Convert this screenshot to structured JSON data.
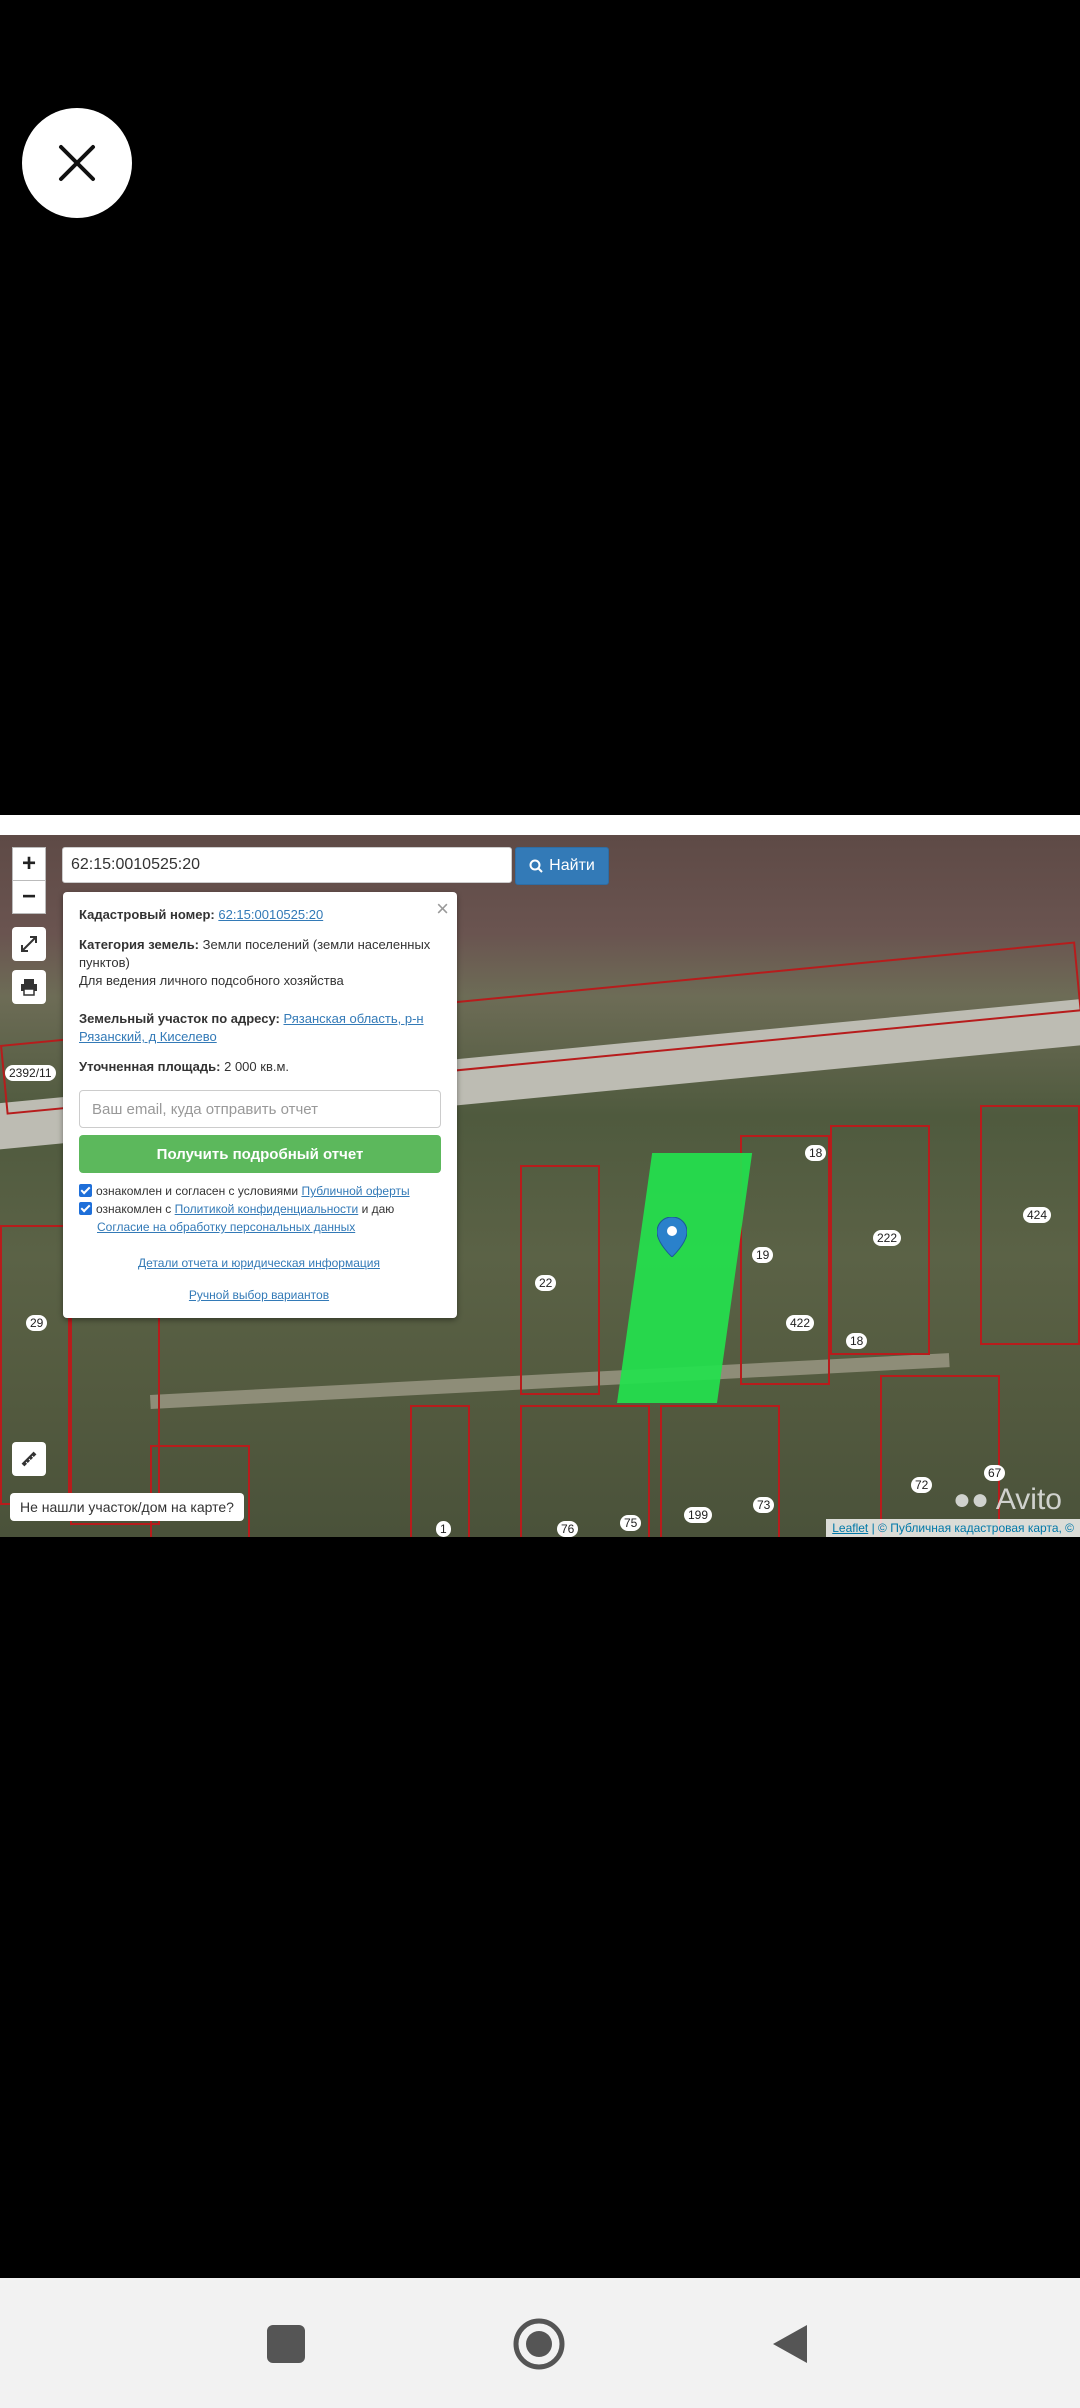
{
  "search": {
    "value": "62:15:0010525:20",
    "button": "Найти"
  },
  "popup": {
    "cadastral_label": "Кадастровый номер:",
    "cadastral_value": "62:15:0010525:20",
    "category_label": "Категория земель:",
    "category_value": "Земли поселений (земли населенных пунктов)",
    "usage": "Для ведения личного подсобного хозяйства",
    "address_label": "Земельный участок по адресу:",
    "address_value": "Рязанская область, р-н Рязанский, д Киселево",
    "area_label": "Уточненная площадь:",
    "area_value": "2 000 кв.м.",
    "email_placeholder": "Ваш email, куда отправить отчет",
    "report_button": "Получить подробный отчет",
    "consent1_text": "ознакомлен и согласен с условиями",
    "consent1_link": "Публичной оферты",
    "consent2_text": "ознакомлен с",
    "consent2_link": "Политикой конфиденциальности",
    "consent2_tail": "и даю",
    "consent2_link2": "Согласие на обработку персональных данных",
    "details_link": "Детали отчета и юридическая информация",
    "manual_link": "Ручной выбор вариантов"
  },
  "map": {
    "not_found": "Не нашли участок/дом на карте?",
    "attribution_leaflet": "Leaflet",
    "attribution_rest": "| © Публичная кадастровая карта, ©",
    "watermark": "Avito",
    "labels": [
      "2392/11",
      "18",
      "19",
      "22",
      "222",
      "424",
      "29",
      "422",
      "18",
      "67",
      "72",
      "73",
      "75",
      "76",
      "199",
      "1"
    ]
  },
  "colors": {
    "plot": "#23e24d",
    "search_btn": "#337ab7",
    "report_btn": "#5cb85c"
  }
}
